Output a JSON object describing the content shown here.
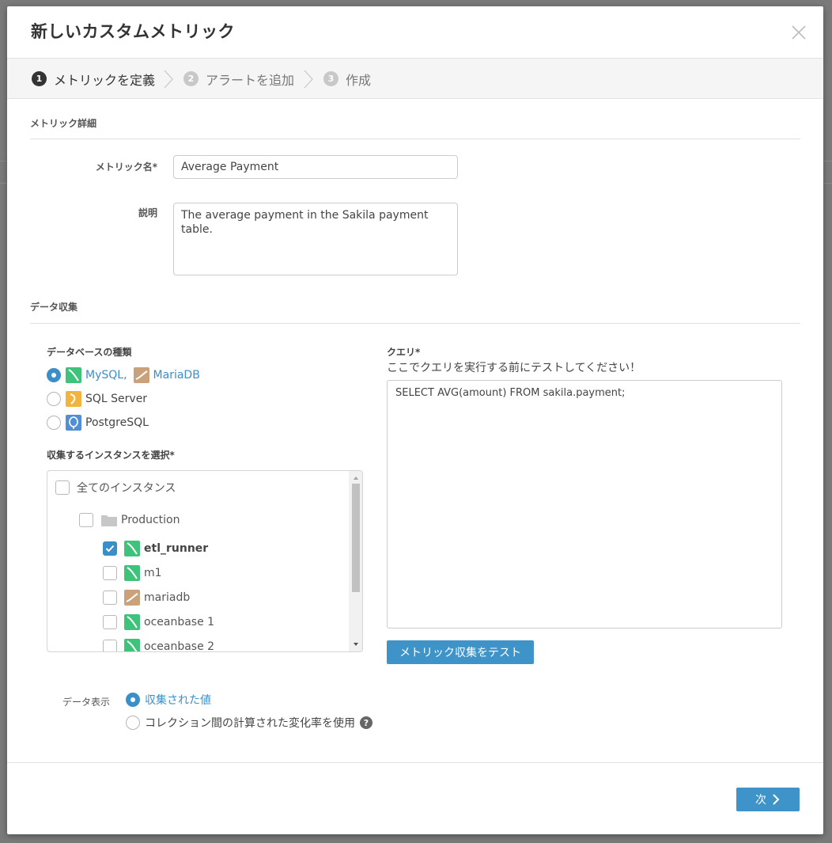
{
  "modal": {
    "title": "新しいカスタムメトリック"
  },
  "wizard": {
    "steps": [
      {
        "num": "1",
        "label": "メトリックを定義"
      },
      {
        "num": "2",
        "label": "アラートを追加"
      },
      {
        "num": "3",
        "label": "作成"
      }
    ]
  },
  "metric_details": {
    "section_title": "メトリック詳細",
    "name_label": "メトリック名*",
    "name_value": "Average Payment",
    "description_label": "説明",
    "description_value": "The average payment in the Sakila payment table."
  },
  "data_collection": {
    "section_title": "データ収集",
    "db_type_label": "データベースの種類",
    "db_types": [
      {
        "label_a": "MySQL,",
        "label_b": "MariaDB",
        "selected": true
      },
      {
        "label_a": "SQL Server",
        "selected": false
      },
      {
        "label_a": "PostgreSQL",
        "selected": false
      }
    ],
    "instances_label": "収集するインスタンスを選択*",
    "instances": {
      "all_label": "全てのインスタンス",
      "group_label": "Production",
      "items": [
        {
          "label": "etl_runner",
          "checked": true,
          "type": "mysql"
        },
        {
          "label": "m1",
          "checked": false,
          "type": "mysql"
        },
        {
          "label": "mariadb",
          "checked": false,
          "type": "mariadb"
        },
        {
          "label": "oceanbase 1",
          "checked": false,
          "type": "mysql"
        },
        {
          "label": "oceanbase 2",
          "checked": false,
          "type": "mysql"
        }
      ]
    },
    "query_label": "クエリ*",
    "query_hint": "ここでクエリを実行する前にテストしてください！",
    "query_value": "SELECT AVG(amount) FROM sakila.payment;",
    "test_button": "メトリック収集をテスト"
  },
  "data_display": {
    "label": "データ表示",
    "options": [
      {
        "label": "収集された値",
        "selected": true
      },
      {
        "label": "コレクション間の計算された変化率を使用",
        "selected": false
      }
    ],
    "help_glyph": "?"
  },
  "footer": {
    "next_button": "次"
  },
  "colors": {
    "accent": "#3e93c9",
    "mysql_icon": "#3ec47a",
    "mariadb_icon": "#c9a27c",
    "sqlserver_icon": "#f2b43c",
    "postgres_icon": "#4f8fd6"
  }
}
